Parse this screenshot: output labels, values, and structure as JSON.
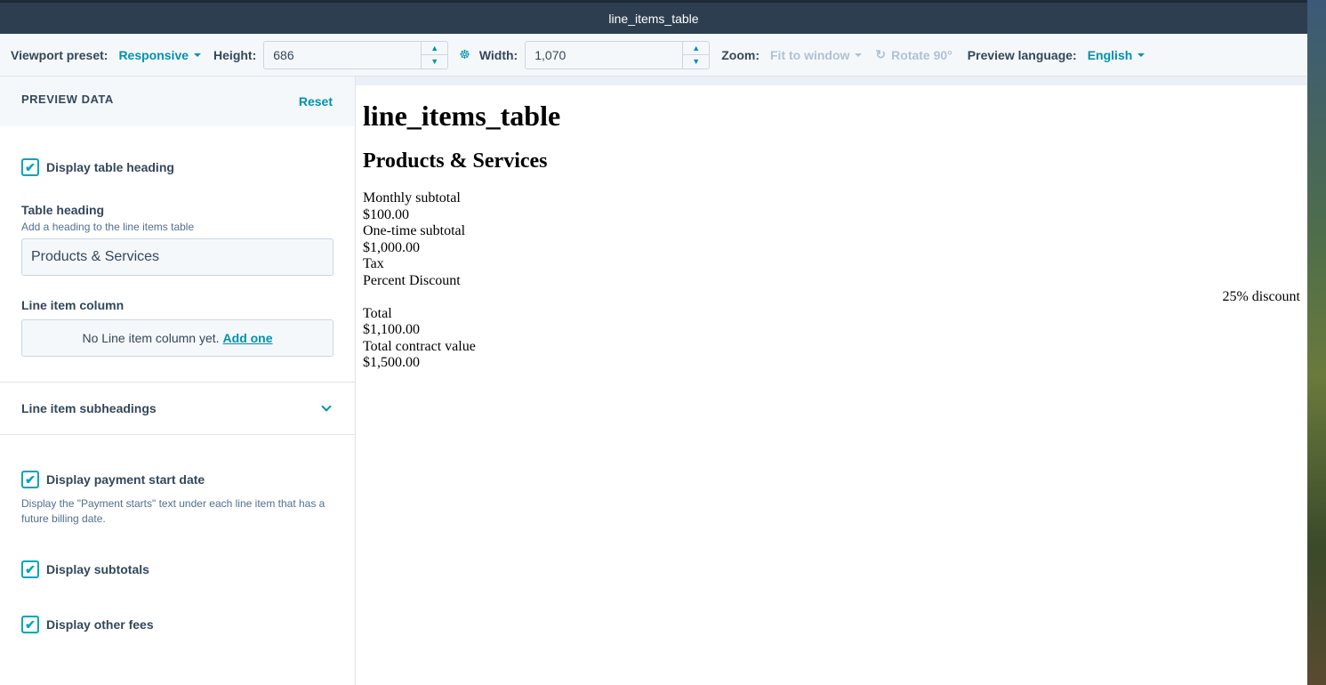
{
  "window": {
    "title": "line_items_table"
  },
  "toolbar": {
    "viewport_label": "Viewport preset:",
    "viewport_value": "Responsive",
    "height_label": "Height:",
    "height_value": "686",
    "width_label": "Width:",
    "width_value": "1,070",
    "zoom_label": "Zoom:",
    "zoom_value": "Fit to window",
    "rotate_label": "Rotate 90°",
    "language_label": "Preview language:",
    "language_value": "English"
  },
  "sidebar": {
    "title": "PREVIEW DATA",
    "reset": "Reset",
    "display_heading": {
      "label": "Display table heading",
      "checked": true
    },
    "table_heading": {
      "label": "Table heading",
      "help": "Add a heading to the line items table",
      "value": "Products & Services"
    },
    "line_item_column": {
      "label": "Line item column",
      "empty_text": "No Line item column yet.",
      "add_link": "Add one"
    },
    "subheadings": {
      "label": "Line item subheadings"
    },
    "payment_start": {
      "label": "Display payment start date",
      "checked": true,
      "help": "Display the \"Payment starts\" text under each line item that has a future billing date."
    },
    "subtotals": {
      "label": "Display subtotals",
      "checked": true
    },
    "other_fees": {
      "label": "Display other fees",
      "checked": true
    }
  },
  "preview": {
    "title": "line_items_table",
    "heading": "Products & Services",
    "lines": {
      "monthly_label": "Monthly subtotal",
      "monthly_value": "$100.00",
      "onetime_label": "One-time subtotal",
      "onetime_value": "$1,000.00",
      "tax_label": "Tax",
      "discount_label": "Percent Discount",
      "discount_value": "25% discount",
      "total_label": "Total",
      "total_value": "$1,100.00",
      "contract_label": "Total contract value",
      "contract_value": "$1,500.00"
    }
  },
  "colors": {
    "titlebar": "#2d3e50",
    "accent": "#0091ae",
    "checkbox": "#00a4bd",
    "text": "#33475b"
  }
}
